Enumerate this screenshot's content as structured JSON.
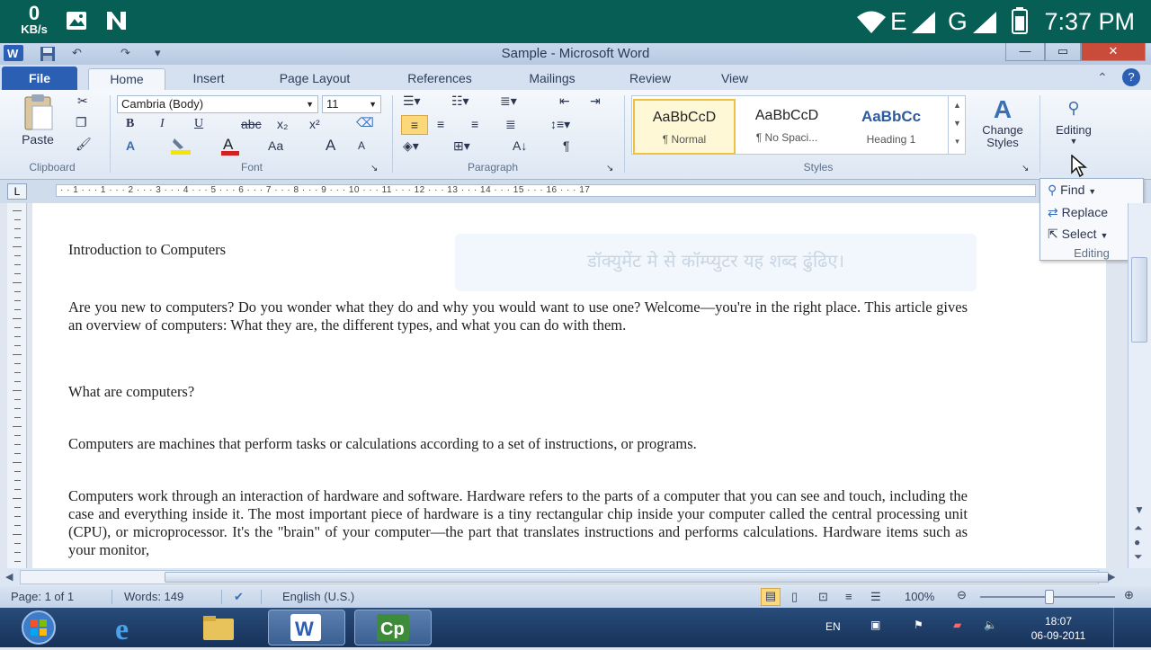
{
  "status_bar": {
    "speed_value": "0",
    "speed_unit": "KB/s",
    "network_e": "E",
    "network_g": "G",
    "time": "7:37 PM"
  },
  "window": {
    "title": "Sample - Microsoft Word"
  },
  "ribbon": {
    "tabs": [
      "File",
      "Home",
      "Insert",
      "Page Layout",
      "References",
      "Mailings",
      "Review",
      "View"
    ],
    "active_tab": "Home",
    "clipboard": {
      "paste_label": "Paste",
      "group_label": "Clipboard"
    },
    "font": {
      "font_name": "Cambria (Body)",
      "font_size": "11",
      "bold": "B",
      "italic": "I",
      "underline": "U",
      "strike": "abc",
      "subscript": "x₂",
      "superscript": "x²",
      "change_case": "Aa",
      "grow": "A",
      "shrink": "A",
      "group_label": "Font"
    },
    "paragraph": {
      "group_label": "Paragraph"
    },
    "styles": {
      "tiles": [
        {
          "preview": "AaBbCcD",
          "name": "¶ Normal"
        },
        {
          "preview": "AaBbCcD",
          "name": "¶ No Spaci..."
        },
        {
          "preview": "AaBbCc",
          "name": "Heading 1"
        }
      ],
      "change_styles_line1": "Change",
      "change_styles_line2": "Styles",
      "group_label": "Styles"
    },
    "editing": {
      "label": "Editing"
    }
  },
  "editing_menu": {
    "find": "Find",
    "replace": "Replace",
    "select": "Select",
    "group_label": "Editing"
  },
  "ruler": {
    "text": "· · 1 · · · 1 · · · 2 · · · 3 · · · 4 · · · 5 · · · 6 · · · 7 · · · 8 · · · 9 · · · 10 · · · 11 · · · 12 · · · 13 · · · 14 · · · 15 · · · 16 · · · 17"
  },
  "document": {
    "hint_text": "डॉक्युमेंट मे से कॉम्प्युटर यह शब्द ढुंढिए।",
    "heading": "Introduction to Computers",
    "p1": "Are you new to computers? Do you wonder what they do and why you would want to use one? Welcome—you're in the right place. This article gives an overview of computers: What they are, the different types, and what you can do with them.",
    "subheading": "What are computers?",
    "p2": "Computers are machines that perform tasks or calculations according to a set of instructions, or programs.",
    "p3": "Computers work through an interaction of hardware and software. Hardware refers to the parts of a computer that you can see and touch, including the case and everything inside it. The most important piece of hardware is a tiny rectangular chip inside your computer called the central processing unit (CPU), or microprocessor. It's the \"brain\" of your computer—the part that translates instructions and performs calculations. Hardware items such as your monitor,"
  },
  "word_status": {
    "page": "Page: 1 of 1",
    "words": "Words: 149",
    "language": "English (U.S.)",
    "zoom": "100%"
  },
  "taskbar": {
    "lang": "EN",
    "time": "18:07",
    "date": "06-09-2011"
  },
  "colors": {
    "android_bar": "#075e54",
    "file_tab": "#2b5fb4",
    "taskbar": "#1e3d68"
  }
}
